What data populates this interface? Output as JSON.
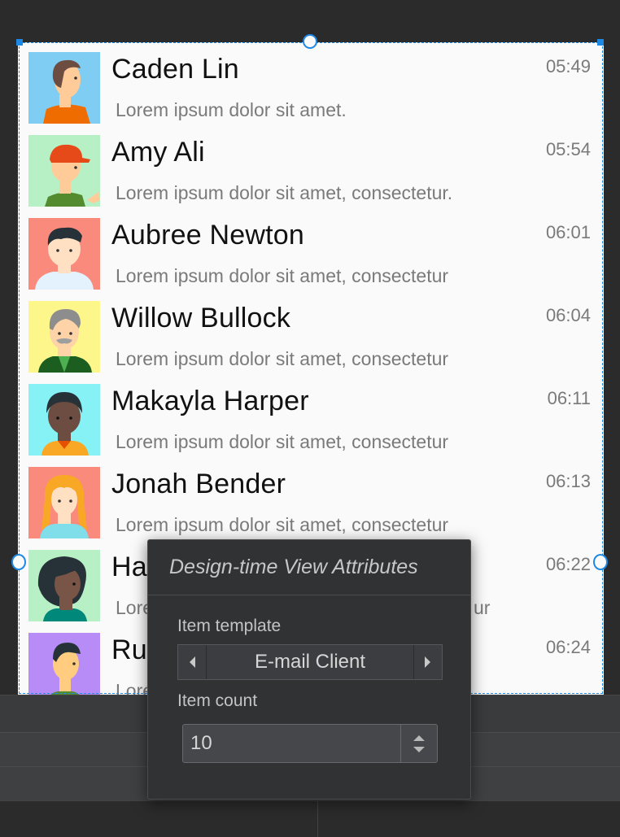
{
  "list": {
    "items": [
      {
        "name": "Caden Lin",
        "message": "Lorem ipsum dolor sit amet.",
        "time": "05:49",
        "avatar_bg": "#7fcdf2"
      },
      {
        "name": "Amy Ali",
        "message": "Lorem ipsum dolor sit amet, consectetur.",
        "time": "05:54",
        "avatar_bg": "#b8f0c6"
      },
      {
        "name": "Aubree Newton",
        "message": "Lorem ipsum dolor sit amet, consectetur",
        "time": "06:01",
        "avatar_bg": "#fa8a7c"
      },
      {
        "name": "Willow Bullock",
        "message": "Lorem ipsum dolor sit amet, consectetur",
        "time": "06:04",
        "avatar_bg": "#fdf68a"
      },
      {
        "name": "Makayla Harper",
        "message": "Lorem ipsum dolor sit amet, consectetur",
        "time": "06:11",
        "avatar_bg": "#86f2f6"
      },
      {
        "name": "Jonah Bender",
        "message": "Lorem ipsum dolor sit amet, consectetur",
        "time": "06:13",
        "avatar_bg": "#fa8a7c"
      },
      {
        "name": "Ha",
        "message": "Lore",
        "message_tail": "ur",
        "time": "06:22",
        "avatar_bg": "#b8f0c6"
      },
      {
        "name": "Ru",
        "message": "Lore",
        "time": "06:24",
        "avatar_bg": "#b88cf6"
      }
    ]
  },
  "popup": {
    "title": "Design-time View Attributes",
    "item_template_label": "Item template",
    "item_template_value": "E-mail Client",
    "item_count_label": "Item count",
    "item_count_value": "10"
  },
  "colors": {
    "selection": "#1e88e5",
    "ide_background": "#2b2b2c",
    "popup_background": "#313234"
  }
}
